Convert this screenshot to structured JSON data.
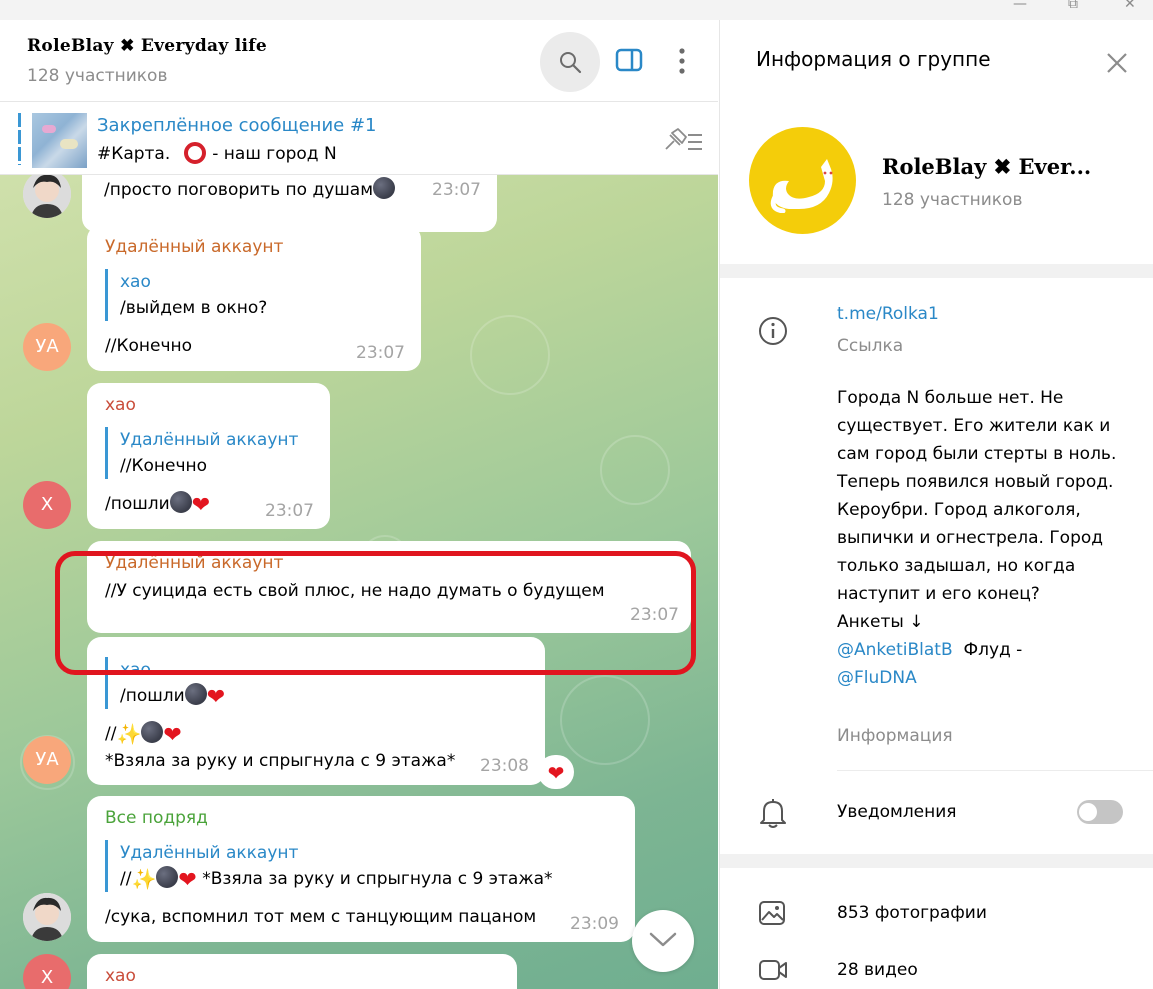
{
  "window": {
    "minimize": "—",
    "maximize": "⧉",
    "close": "✕"
  },
  "chat": {
    "title": "RoleBlay ✖ Everyday life",
    "subtitle": "128 участников",
    "pinned": {
      "title": "Закреплённое сообщение #1",
      "text_before": "#Карта.",
      "text_after": "- наш город N"
    },
    "messages": [
      {
        "text": "/просто поговорить по душам",
        "time": "23:07"
      },
      {
        "sender": "Удалённый аккаунт",
        "quote_name": "хао",
        "quote_text": "/выйдем в окно?",
        "text": "//Конечно",
        "time": "23:07",
        "avatar": "УА"
      },
      {
        "sender": "хао",
        "quote_name": "Удалённый аккаунт",
        "quote_text": "//Конечно",
        "text": "/пошли",
        "time": "23:07",
        "avatar": "Х"
      },
      {
        "sender": "Удалённый аккаунт",
        "text": "//У суицида есть свой плюс, не надо думать о будущем",
        "time": "23:07"
      },
      {
        "quote_name": "хао",
        "quote_text": "/пошли",
        "text_line1": "//",
        "text_line2": "*Взяла за руку и спрыгнула с 9 этажа*",
        "time": "23:08",
        "avatar": "УА"
      },
      {
        "sender": "Все подряд",
        "quote_name": "Удалённый аккаунт",
        "quote_text_prefix": "//",
        "quote_text": "*Взяла за руку и спрыгнула с 9 этажа*",
        "text": "/сука, вспомнил тот мем с танцующим пацаном",
        "time": "23:09"
      },
      {
        "sender": "хао",
        "avatar": "Х"
      }
    ]
  },
  "info": {
    "title": "Информация о группе",
    "name": "RoleBlay ✖ Ever...",
    "members": "128 участников",
    "link": "t.me/Rolka1",
    "link_caption": "Ссылка",
    "description": "Города N больше нет. Не существует. Его жители как и сам город были стерты в ноль. Теперь появился новый город. Кероубри. Город алкоголя, выпички и огнестрела. Город только задышал, но когда наступит и его конец?",
    "anketi_label": "Анкеты ↓",
    "anketi_link": "@AnketiBlatB",
    "flood_label": "Флуд -",
    "flood_link": "@FluDNA",
    "desc_caption": "Информация",
    "notifications": "Уведомления",
    "photos": "853 фотографии",
    "videos": "28 видео"
  },
  "colors": {
    "accent": "#2a88c7",
    "highlight": "#e0151f",
    "avatar_yellow": "#f4cd0a",
    "sender_orange": "#c9692a",
    "sender_red": "#c94d3a",
    "sender_green": "#4aa33a"
  }
}
